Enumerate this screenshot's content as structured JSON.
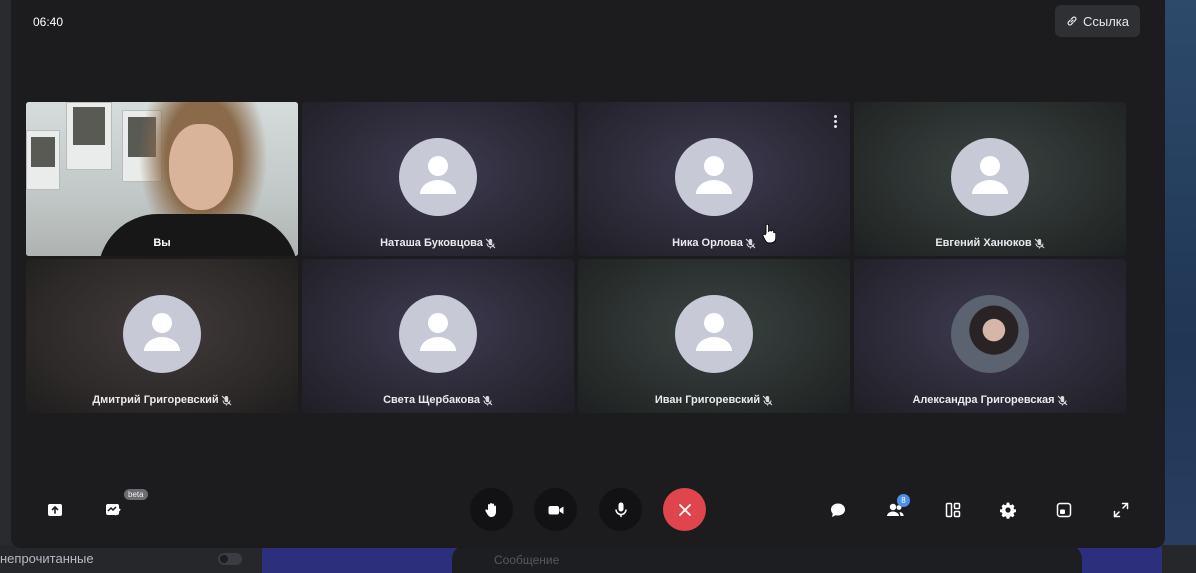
{
  "call": {
    "timer": "06:40",
    "link_label": "Ссылка"
  },
  "participants": [
    {
      "name": "Вы",
      "muted": false,
      "video": true
    },
    {
      "name": "Наташа Буковцова",
      "muted": true,
      "video": false
    },
    {
      "name": "Ника Орлова",
      "muted": true,
      "video": false
    },
    {
      "name": "Евгений Ханюков",
      "muted": true,
      "video": false
    },
    {
      "name": "Дмитрий Григоревский",
      "muted": true,
      "video": false
    },
    {
      "name": "Света Щербакова",
      "muted": true,
      "video": false
    },
    {
      "name": "Иван Григоревский",
      "muted": true,
      "video": false
    },
    {
      "name": "Александра Григоревская",
      "muted": true,
      "video": false,
      "photo_avatar": true
    }
  ],
  "toolbar": {
    "left": [
      "screen-share-icon",
      "whiteboard-icon"
    ],
    "beta_label": "beta",
    "center": [
      "raise-hand-icon",
      "camera-icon",
      "microphone-icon",
      "end-call-icon"
    ],
    "right": [
      "chat-icon",
      "participants-icon",
      "layout-icon",
      "settings-icon",
      "minimize-icon",
      "fullscreen-icon"
    ],
    "participants_count": "8"
  },
  "background": {
    "unread_label": "непрочитанные",
    "message_placeholder": "Сообщение"
  },
  "colors": {
    "end_call": "#e0444c",
    "badge": "#4d8fea",
    "avatar": "#c7c9d6"
  }
}
